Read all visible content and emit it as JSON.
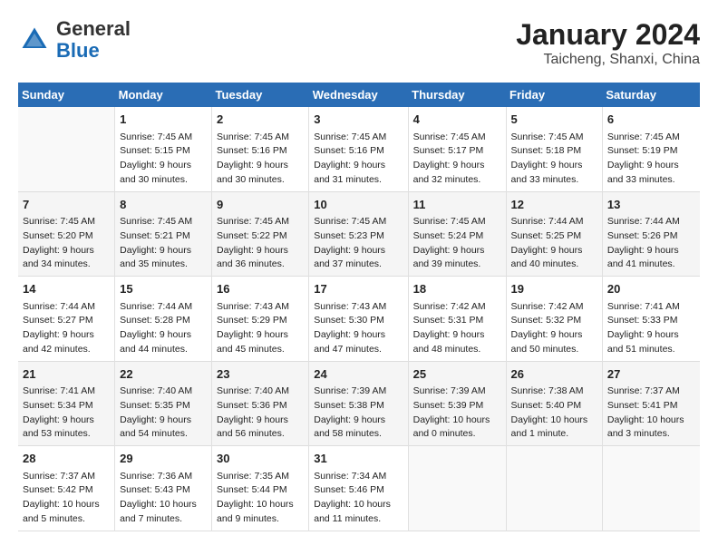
{
  "header": {
    "logo_general": "General",
    "logo_blue": "Blue",
    "month_title": "January 2024",
    "location": "Taicheng, Shanxi, China"
  },
  "days_of_week": [
    "Sunday",
    "Monday",
    "Tuesday",
    "Wednesday",
    "Thursday",
    "Friday",
    "Saturday"
  ],
  "weeks": [
    [
      {
        "day": "",
        "content": ""
      },
      {
        "day": "1",
        "content": "Sunrise: 7:45 AM\nSunset: 5:15 PM\nDaylight: 9 hours\nand 30 minutes."
      },
      {
        "day": "2",
        "content": "Sunrise: 7:45 AM\nSunset: 5:16 PM\nDaylight: 9 hours\nand 30 minutes."
      },
      {
        "day": "3",
        "content": "Sunrise: 7:45 AM\nSunset: 5:16 PM\nDaylight: 9 hours\nand 31 minutes."
      },
      {
        "day": "4",
        "content": "Sunrise: 7:45 AM\nSunset: 5:17 PM\nDaylight: 9 hours\nand 32 minutes."
      },
      {
        "day": "5",
        "content": "Sunrise: 7:45 AM\nSunset: 5:18 PM\nDaylight: 9 hours\nand 33 minutes."
      },
      {
        "day": "6",
        "content": "Sunrise: 7:45 AM\nSunset: 5:19 PM\nDaylight: 9 hours\nand 33 minutes."
      }
    ],
    [
      {
        "day": "7",
        "content": "Sunrise: 7:45 AM\nSunset: 5:20 PM\nDaylight: 9 hours\nand 34 minutes."
      },
      {
        "day": "8",
        "content": "Sunrise: 7:45 AM\nSunset: 5:21 PM\nDaylight: 9 hours\nand 35 minutes."
      },
      {
        "day": "9",
        "content": "Sunrise: 7:45 AM\nSunset: 5:22 PM\nDaylight: 9 hours\nand 36 minutes."
      },
      {
        "day": "10",
        "content": "Sunrise: 7:45 AM\nSunset: 5:23 PM\nDaylight: 9 hours\nand 37 minutes."
      },
      {
        "day": "11",
        "content": "Sunrise: 7:45 AM\nSunset: 5:24 PM\nDaylight: 9 hours\nand 39 minutes."
      },
      {
        "day": "12",
        "content": "Sunrise: 7:44 AM\nSunset: 5:25 PM\nDaylight: 9 hours\nand 40 minutes."
      },
      {
        "day": "13",
        "content": "Sunrise: 7:44 AM\nSunset: 5:26 PM\nDaylight: 9 hours\nand 41 minutes."
      }
    ],
    [
      {
        "day": "14",
        "content": "Sunrise: 7:44 AM\nSunset: 5:27 PM\nDaylight: 9 hours\nand 42 minutes."
      },
      {
        "day": "15",
        "content": "Sunrise: 7:44 AM\nSunset: 5:28 PM\nDaylight: 9 hours\nand 44 minutes."
      },
      {
        "day": "16",
        "content": "Sunrise: 7:43 AM\nSunset: 5:29 PM\nDaylight: 9 hours\nand 45 minutes."
      },
      {
        "day": "17",
        "content": "Sunrise: 7:43 AM\nSunset: 5:30 PM\nDaylight: 9 hours\nand 47 minutes."
      },
      {
        "day": "18",
        "content": "Sunrise: 7:42 AM\nSunset: 5:31 PM\nDaylight: 9 hours\nand 48 minutes."
      },
      {
        "day": "19",
        "content": "Sunrise: 7:42 AM\nSunset: 5:32 PM\nDaylight: 9 hours\nand 50 minutes."
      },
      {
        "day": "20",
        "content": "Sunrise: 7:41 AM\nSunset: 5:33 PM\nDaylight: 9 hours\nand 51 minutes."
      }
    ],
    [
      {
        "day": "21",
        "content": "Sunrise: 7:41 AM\nSunset: 5:34 PM\nDaylight: 9 hours\nand 53 minutes."
      },
      {
        "day": "22",
        "content": "Sunrise: 7:40 AM\nSunset: 5:35 PM\nDaylight: 9 hours\nand 54 minutes."
      },
      {
        "day": "23",
        "content": "Sunrise: 7:40 AM\nSunset: 5:36 PM\nDaylight: 9 hours\nand 56 minutes."
      },
      {
        "day": "24",
        "content": "Sunrise: 7:39 AM\nSunset: 5:38 PM\nDaylight: 9 hours\nand 58 minutes."
      },
      {
        "day": "25",
        "content": "Sunrise: 7:39 AM\nSunset: 5:39 PM\nDaylight: 10 hours\nand 0 minutes."
      },
      {
        "day": "26",
        "content": "Sunrise: 7:38 AM\nSunset: 5:40 PM\nDaylight: 10 hours\nand 1 minute."
      },
      {
        "day": "27",
        "content": "Sunrise: 7:37 AM\nSunset: 5:41 PM\nDaylight: 10 hours\nand 3 minutes."
      }
    ],
    [
      {
        "day": "28",
        "content": "Sunrise: 7:37 AM\nSunset: 5:42 PM\nDaylight: 10 hours\nand 5 minutes."
      },
      {
        "day": "29",
        "content": "Sunrise: 7:36 AM\nSunset: 5:43 PM\nDaylight: 10 hours\nand 7 minutes."
      },
      {
        "day": "30",
        "content": "Sunrise: 7:35 AM\nSunset: 5:44 PM\nDaylight: 10 hours\nand 9 minutes."
      },
      {
        "day": "31",
        "content": "Sunrise: 7:34 AM\nSunset: 5:46 PM\nDaylight: 10 hours\nand 11 minutes."
      },
      {
        "day": "",
        "content": ""
      },
      {
        "day": "",
        "content": ""
      },
      {
        "day": "",
        "content": ""
      }
    ]
  ]
}
